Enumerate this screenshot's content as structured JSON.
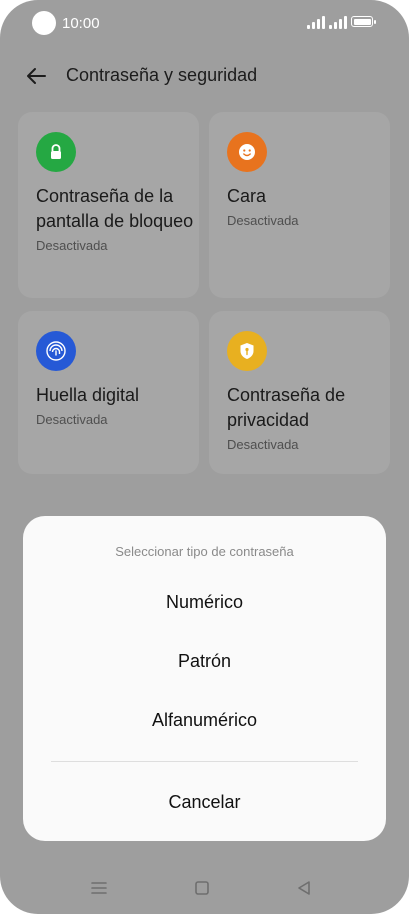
{
  "status_bar": {
    "time": "10:00"
  },
  "header": {
    "title": "Contraseña y seguridad"
  },
  "cards": [
    {
      "title": "Contraseña de la pantalla de bloqueo",
      "status": "Desactivada",
      "icon": "lock-icon",
      "color": "#25a843"
    },
    {
      "title": "Cara",
      "status": "Desactivada",
      "icon": "face-icon",
      "color": "#e8731e"
    },
    {
      "title": "Huella digital",
      "status": "Desactivada",
      "icon": "fingerprint-icon",
      "color": "#2659d6"
    },
    {
      "title": "Contraseña de privacidad",
      "status": "Desactivada",
      "icon": "privacy-shield-icon",
      "color": "#e8b020"
    }
  ],
  "sheet": {
    "title": "Seleccionar tipo de contraseña",
    "options": [
      "Numérico",
      "Patrón",
      "Alfanumérico"
    ],
    "cancel": "Cancelar"
  },
  "nav": {
    "icons": [
      "menu-icon",
      "home-icon",
      "back-icon"
    ]
  }
}
